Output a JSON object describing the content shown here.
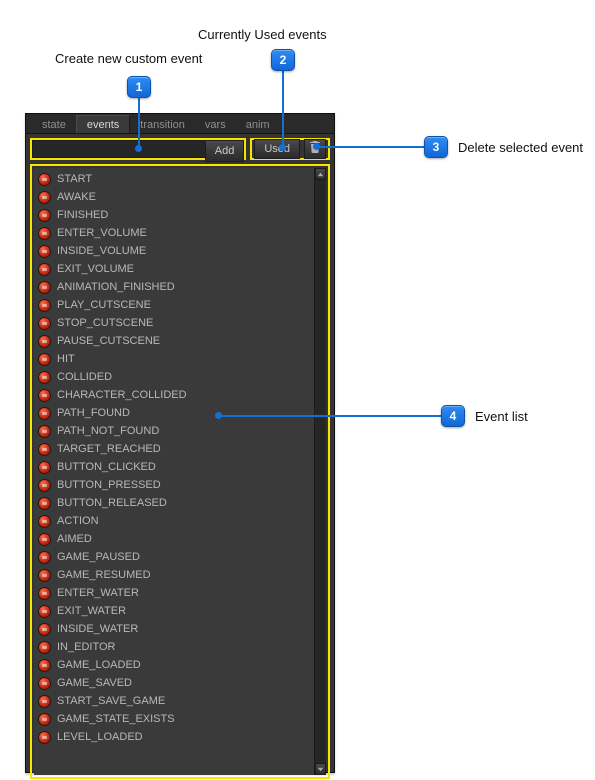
{
  "tabs": {
    "state": "state",
    "events": "events",
    "transition": "transition",
    "vars": "vars",
    "anim": "anim"
  },
  "toolbar": {
    "new_event_value": "",
    "add_label": "Add",
    "used_label": "Used"
  },
  "events": [
    "START",
    "AWAKE",
    "FINISHED",
    "ENTER_VOLUME",
    "INSIDE_VOLUME",
    "EXIT_VOLUME",
    "ANIMATION_FINISHED",
    "PLAY_CUTSCENE",
    "STOP_CUTSCENE",
    "PAUSE_CUTSCENE",
    "HIT",
    "COLLIDED",
    "CHARACTER_COLLIDED",
    "PATH_FOUND",
    "PATH_NOT_FOUND",
    "TARGET_REACHED",
    "BUTTON_CLICKED",
    "BUTTON_PRESSED",
    "BUTTON_RELEASED",
    "ACTION",
    "AIMED",
    "GAME_PAUSED",
    "GAME_RESUMED",
    "ENTER_WATER",
    "EXIT_WATER",
    "INSIDE_WATER",
    "IN_EDITOR",
    "GAME_LOADED",
    "GAME_SAVED",
    "START_SAVE_GAME",
    "GAME_STATE_EXISTS",
    "LEVEL_LOADED"
  ],
  "callouts": {
    "c1": {
      "num": "1",
      "label": "Create new custom event"
    },
    "c2": {
      "num": "2",
      "label": "Currently Used events"
    },
    "c3": {
      "num": "3",
      "label": "Delete selected event"
    },
    "c4": {
      "num": "4",
      "label": "Event list"
    }
  }
}
